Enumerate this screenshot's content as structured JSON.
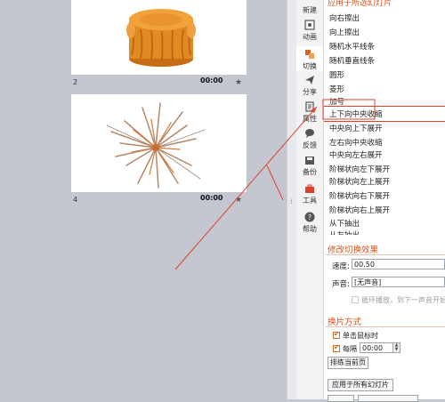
{
  "slides": [
    {
      "number": "2",
      "time": "00:00",
      "has_transition_icon": true,
      "content": "mooncake"
    },
    {
      "number": "4",
      "time": "00:00",
      "has_transition_icon": true,
      "content": "fireworks"
    }
  ],
  "toolbar": {
    "items": [
      {
        "label": "新建",
        "icon": "new-icon"
      },
      {
        "label": "动画",
        "icon": "animation-icon"
      },
      {
        "label": "切换",
        "icon": "transition-icon",
        "active": true
      },
      {
        "label": "分享",
        "icon": "share-icon"
      },
      {
        "label": "属性",
        "icon": "properties-icon"
      },
      {
        "label": "反馈",
        "icon": "feedback-icon"
      },
      {
        "label": "备份",
        "icon": "backup-icon"
      },
      {
        "label": "工具",
        "icon": "tools-icon"
      },
      {
        "label": "帮助",
        "icon": "help-icon"
      }
    ]
  },
  "panel": {
    "header": "应用于所选幻灯片",
    "effects": [
      "向右擦出",
      "向上擦出",
      "随机水平线条",
      "随机垂直线条",
      "圆形",
      "菱形",
      "加号",
      "上下向中央收缩",
      "中央向上下展开",
      "左右向中央收缩",
      "中央向左右展开",
      "阶梯状向左下展开",
      "阶梯状向左上展开",
      "阶梯状向右下展开",
      "阶梯状向右上展开",
      "从下抽出",
      "从左抽出"
    ],
    "selected_index": 7,
    "modify_title": "修改切换效果",
    "speed_label": "速度:",
    "speed_value": "00.50",
    "sound_label": "声音:",
    "sound_value": "[无声音]",
    "loop_label": "循环播放，到下一声音开始时",
    "advance_title": "换片方式",
    "on_click_label": "单击鼠标时",
    "every_label": "每隔",
    "every_value": "00:00",
    "rehearse_button": "排练当前页",
    "apply_all_button": "应用于所有幻灯片"
  }
}
